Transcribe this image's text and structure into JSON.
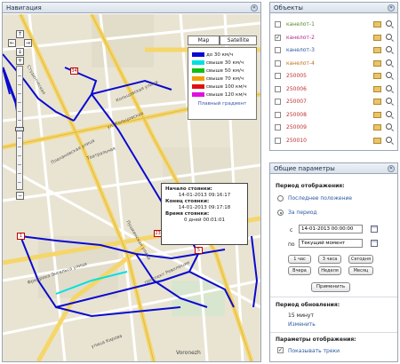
{
  "nav_panel": {
    "title": "Навигация",
    "map": {
      "type_buttons": [
        "Map",
        "Satellite"
      ],
      "legend": {
        "rows": [
          {
            "color": "#0a0ad0",
            "label": "до 30 км/ч"
          },
          {
            "color": "#00e0e0",
            "label": "свыше 30 км/ч"
          },
          {
            "color": "#10c010",
            "label": "свыше 50 км/ч"
          },
          {
            "color": "#f0a000",
            "label": "свыше 70 км/ч"
          },
          {
            "color": "#e01010",
            "label": "свыше 100 км/ч"
          },
          {
            "color": "#e010e0",
            "label": "свыше 120 км/ч"
          }
        ],
        "gradient_link": "Плавный градиент"
      },
      "popup": {
        "stop_start_label": "Начало стоянки:",
        "stop_start_value": "14-01-2013 09:16:17",
        "stop_end_label": "Конец стоянки:",
        "stop_end_value": "14-01-2013 09:17:18",
        "stop_time_label": "Время стоянки:",
        "stop_time_value": "0 дней 00:01:01"
      },
      "markers": [
        "34",
        "1",
        "23",
        "5"
      ],
      "credit": "Voronezh",
      "street_labels": [
        "Кольцовская улица",
        "ул. Кольцовская",
        "Студенческая",
        "улица Кирова",
        "Плехановская улица",
        "Пушкинская улица",
        "проспект Революции",
        "Театральная",
        "Фридриха Энгельса улица"
      ]
    }
  },
  "objects_panel": {
    "title": "Объекты",
    "items": [
      {
        "name": "канелот-1",
        "checked": false,
        "color": "#5a8a2a"
      },
      {
        "name": "канелот-2",
        "checked": true,
        "color": "#b02a8a"
      },
      {
        "name": "канелот-3",
        "checked": false,
        "color": "#2a5aa0"
      },
      {
        "name": "канелот-4",
        "checked": false,
        "color": "#c07020"
      },
      {
        "name": "250005",
        "checked": false,
        "color": "#c03030"
      },
      {
        "name": "250006",
        "checked": false,
        "color": "#c03030"
      },
      {
        "name": "250007",
        "checked": false,
        "color": "#c03030"
      },
      {
        "name": "250008",
        "checked": false,
        "color": "#c03030"
      },
      {
        "name": "250009",
        "checked": false,
        "color": "#c03030"
      },
      {
        "name": "250010",
        "checked": false,
        "color": "#c03030"
      }
    ]
  },
  "params_panel": {
    "title": "Общие параметры",
    "display_period_title": "Период отображения:",
    "radio_last": "Последнее положение",
    "radio_period": "За период",
    "from_label": "с",
    "from_value": "14-01-2013 00:00:00",
    "to_label": "по",
    "to_value": "Текущий момент",
    "quick_buttons": [
      "1 час",
      "3 часа",
      "Сегодня",
      "Вчера",
      "Неделя",
      "Месяц"
    ],
    "apply_button": "Применить",
    "update_period_title": "Период обновления:",
    "update_value": "15 минут",
    "update_change_link": "Изменить",
    "display_params_title": "Параметры отображения:",
    "show_tracks_label": "Показывать треки"
  }
}
